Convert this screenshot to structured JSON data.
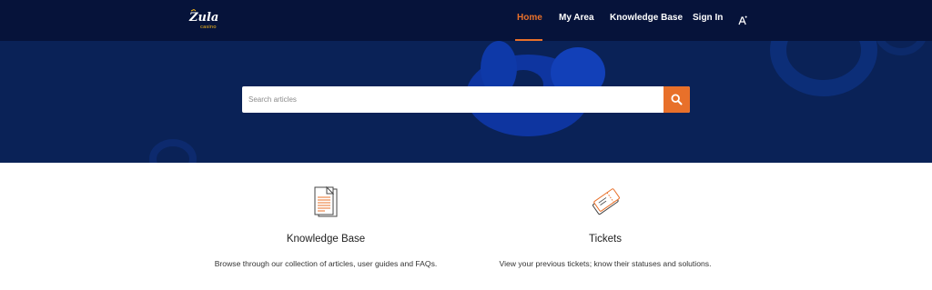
{
  "brand": {
    "logo_text": "Zula",
    "logo_subtext": "casino",
    "accent": "#e8702a",
    "nav_background": "#06133a",
    "hero_background": "#0a2257"
  },
  "nav": {
    "items": [
      {
        "label": "Home",
        "active": true
      },
      {
        "label": "My Area",
        "active": false
      },
      {
        "label": "Knowledge Base",
        "active": false
      },
      {
        "label": "Sign In",
        "active": false
      }
    ],
    "accessibility_icon": "font-size-icon"
  },
  "search": {
    "placeholder": "Search articles",
    "value": "",
    "icon": "search-icon"
  },
  "cards": [
    {
      "icon": "document-stack-icon",
      "title": "Knowledge Base",
      "description": "Browse through our collection of articles, user guides and FAQs."
    },
    {
      "icon": "ticket-icon",
      "title": "Tickets",
      "description": "View your previous tickets; know their statuses and solutions."
    }
  ]
}
